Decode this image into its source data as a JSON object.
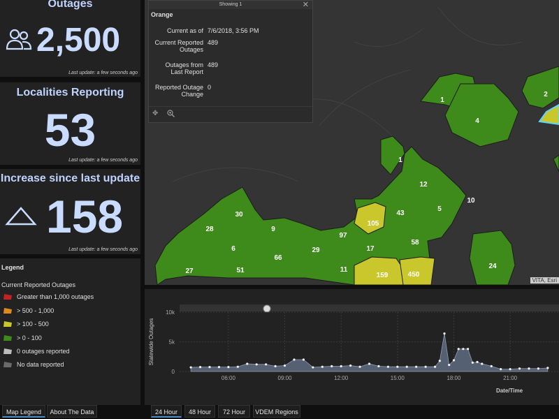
{
  "indicators": {
    "outages": {
      "title": "Outages",
      "value": "2,500",
      "update": "Last update: a few seconds ago"
    },
    "localities": {
      "title": "Localities Reporting",
      "value": "53",
      "update": "Last update: a few seconds ago"
    },
    "increase": {
      "title": "Increase since last update",
      "value": "158",
      "update": "Last update: a few seconds ago"
    }
  },
  "legend": {
    "header": "Legend",
    "subtitle": "Current Reported Outages",
    "items": [
      {
        "label": "Greater than 1,000 outages",
        "color": "#c42127"
      },
      {
        "label": "> 500 - 1,000",
        "color": "#e08a1e"
      },
      {
        "label": "> 100 - 500",
        "color": "#c9c72c"
      },
      {
        "label": "> 0 - 100",
        "color": "#3e8a1a"
      },
      {
        "label": "0 outages reported",
        "color": "#bdbdbd"
      },
      {
        "label": "No data reported",
        "color": "#6a6a6a"
      }
    ]
  },
  "left_tabs": {
    "map_legend": "Map Legend",
    "about": "About The Data"
  },
  "popup": {
    "header": "Showing 1",
    "title": "Orange",
    "rows": [
      {
        "label1": "Current as of",
        "label2": "",
        "value": "7/6/2018, 3:56 PM"
      },
      {
        "label1": "Current Reported",
        "label2": "Outages",
        "value": "489"
      },
      {
        "label1": "Outages from",
        "label2": "Last Report",
        "value": "489"
      },
      {
        "label1": "Reported Outage",
        "label2": "Change",
        "value": "0"
      }
    ]
  },
  "map": {
    "attribution": "VITA, Esri",
    "labels": [
      "1",
      "4",
      "2",
      "1",
      "12",
      "10",
      "43",
      "5",
      "105",
      "30",
      "9",
      "97",
      "28",
      "6",
      "29",
      "17",
      "58",
      "66",
      "11",
      "27",
      "51",
      "159",
      "450",
      "24"
    ]
  },
  "bottom_tabs": {
    "h24": "24 Hour",
    "h48": "48 Hour",
    "h72": "72 Hour",
    "vdem": "VDEM Regions"
  },
  "chart_data": {
    "type": "area",
    "ylabel": "Statewide Outages",
    "xlabel": "Date/Time",
    "y_ticks": [
      "0",
      "5k",
      "10k"
    ],
    "x_ticks": [
      "06:00",
      "09:00",
      "12:00",
      "15:00",
      "18:00",
      "21:00"
    ],
    "ylim": [
      0,
      10000
    ],
    "x_hours": [
      4,
      4.5,
      5,
      5.5,
      6,
      6.5,
      7,
      7.5,
      8,
      8.5,
      9,
      9.5,
      10,
      10.5,
      11,
      11.5,
      12,
      12.5,
      13,
      13.5,
      14,
      14.5,
      15,
      15.5,
      16,
      16.5,
      17,
      17.25,
      17.5,
      17.75,
      18,
      18.25,
      18.5,
      18.75,
      19,
      19.25,
      19.5,
      20,
      20.5,
      21,
      21.5,
      22,
      22.5,
      23
    ],
    "values": [
      700,
      750,
      750,
      750,
      750,
      800,
      1300,
      1200,
      1200,
      900,
      1000,
      2000,
      2000,
      700,
      800,
      900,
      900,
      1000,
      800,
      1300,
      900,
      800,
      800,
      800,
      800,
      800,
      800,
      1800,
      6400,
      1100,
      1900,
      3800,
      3800,
      3800,
      1500,
      1600,
      1300,
      900,
      400,
      400,
      500,
      500,
      500,
      600
    ]
  }
}
